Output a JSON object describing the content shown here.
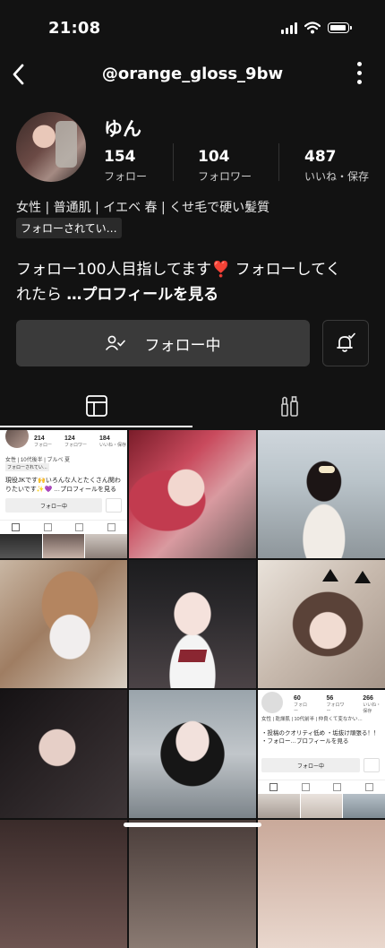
{
  "status_bar": {
    "time": "21:08"
  },
  "header": {
    "handle": "@orange_gloss_9bw"
  },
  "profile": {
    "name": "ゆん",
    "stats": [
      {
        "value": "154",
        "label": "フォロー"
      },
      {
        "value": "104",
        "label": "フォロワー"
      },
      {
        "value": "487",
        "label": "いいね・保存"
      }
    ],
    "tags": "女性 | 普通肌 | イエベ 春 | くせ毛で硬い髪質",
    "followed_badge": "フォローされてい…",
    "bio_line1": "フォロー100人目指してます",
    "bio_heart": "❣️",
    "bio_line1b": " フォローしてく",
    "bio_line2": "れたら ",
    "bio_more": "…プロフィールを見る",
    "follow_button": "フォロー中"
  },
  "tabs": [
    {
      "name": "posts"
    },
    {
      "name": "cosmetics"
    }
  ],
  "grid": {
    "thumb1": {
      "stats": [
        "214",
        "124",
        "184"
      ],
      "stat_labels": [
        "フォロー",
        "フォロワー",
        "いいね・保存"
      ],
      "tags": "女性 | 10代後半 | ブルべ 夏",
      "badge": "フォローされてい…",
      "bio": "現役JKです🙌いろんな人とたくさん関わりたいです✨💜 …プロフィールを見る",
      "button": "フォロー中"
    },
    "thumb9": {
      "stats": [
        "60",
        "56",
        "266"
      ],
      "stat_labels": [
        "フォロー",
        "フォロワー",
        "いいね・保存"
      ],
      "tags": "女性 | 乾燥肌 | 10代前半 | 仲良くて変なかい…",
      "bio": "・投稿のクオリティ低め ・垢抜け頑張る！！ ・フォロー…プロフィールを見る",
      "button": "フォロー中"
    }
  },
  "colors": {
    "background": "#121212",
    "button_bg": "#3a3a3a",
    "heart": "#e8434f"
  }
}
